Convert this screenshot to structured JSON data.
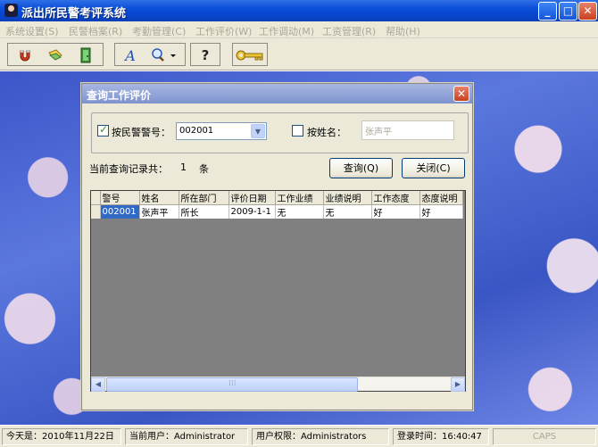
{
  "window": {
    "title": "派出所民警考评系统"
  },
  "menu": [
    "系统设置(S)",
    "民警档案(R)",
    "考勤管理(C)",
    "工作评价(W)",
    "工作调动(M)",
    "工资管理(R)",
    "帮助(H)"
  ],
  "toolbar": {
    "icons": [
      "magnet-icon",
      "folder-icon",
      "door-exit-icon",
      "font-icon",
      "search-icon",
      "help-icon",
      "key-icon"
    ],
    "help_glyph": "?",
    "font_glyph": "A"
  },
  "dialog": {
    "title": "查询工作评价",
    "by_police_id_label": "按民警警号：",
    "by_police_id_checked": true,
    "police_id_value": "002001",
    "by_name_label": "按姓名：",
    "by_name_checked": false,
    "name_value": "张声平",
    "record_count_label": "当前查询记录共：",
    "record_count": "1",
    "record_count_unit": "条",
    "query_button": "查询(Q)",
    "close_button": "关闭(C)",
    "columns": [
      "警号",
      "姓名",
      "所在部门",
      "评价日期",
      "工作业绩",
      "业绩说明",
      "工作态度",
      "态度说明"
    ],
    "rows": [
      [
        "002001",
        "张声平",
        "所长",
        "2009-1-1",
        "无",
        "无",
        "好",
        "好"
      ]
    ]
  },
  "statusbar": {
    "today": "今天是：2010年11月22日",
    "current_user": "当前用户：Administrator",
    "permission": "用户权限：Administrators",
    "login_time": "登录时间：16:40:47",
    "caps": "CAPS"
  },
  "colors": {
    "titlebar": "#0a4ed8",
    "dialog_title": "#8fa2d6",
    "selection": "#316ac5",
    "grid_empty": "#808080"
  }
}
